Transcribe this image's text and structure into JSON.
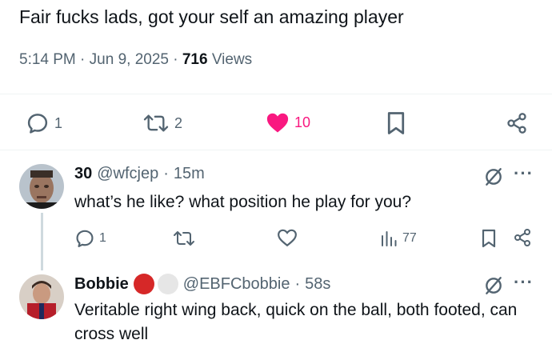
{
  "tweet": {
    "text": "Fair fucks lads, got your self an amazing player",
    "time": "5:14 PM",
    "date": "Jun 9, 2025",
    "views_count": "716",
    "views_label": "Views",
    "separator": "·"
  },
  "actions": {
    "replies": "1",
    "reposts": "2",
    "likes": "10",
    "like_color": "#f91880",
    "icons": [
      "reply-icon",
      "repost-icon",
      "heart-icon",
      "bookmark-icon",
      "share-icon"
    ]
  },
  "replies": [
    {
      "name": "30",
      "handle": "@wfcjep",
      "time": "15m",
      "text": "what’s he like? what position he play for you?",
      "reply_count": "1",
      "views": "77"
    },
    {
      "name": "Bobbie",
      "handle": "@EBFCbobbie",
      "time": "58s",
      "text": "Veritable right wing back, quick on the ball, both footed, can cross well",
      "badge_colors": [
        "#d62828",
        "#e6e6e6"
      ]
    }
  ],
  "colors": {
    "text_primary": "#0f1419",
    "text_secondary": "#536471",
    "divider": "#eff3f4",
    "thread_line": "#cfd9de"
  }
}
